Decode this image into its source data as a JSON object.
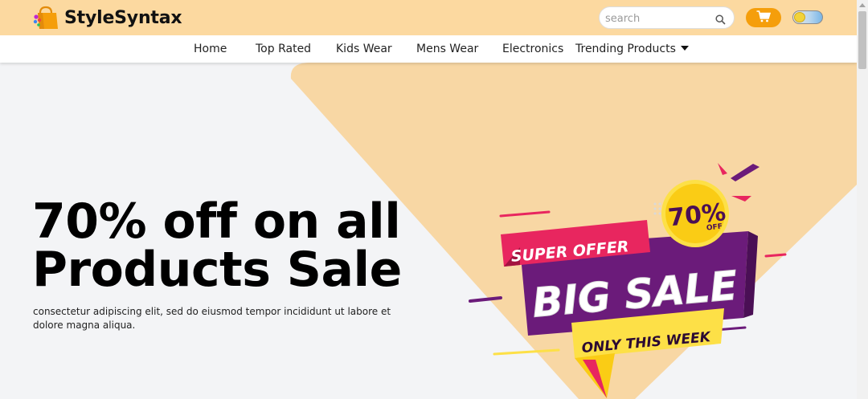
{
  "header": {
    "brand": "StyleSyntax",
    "search_placeholder": "search",
    "cart_icon": "cart-icon",
    "theme_toggle_icon": "theme-toggle"
  },
  "nav": {
    "items": [
      {
        "label": "Home"
      },
      {
        "label": "Top Rated"
      },
      {
        "label": "Kids Wear"
      },
      {
        "label": "Mens Wear"
      },
      {
        "label": "Electronics"
      },
      {
        "label": "Trending Products"
      }
    ]
  },
  "hero": {
    "title_line1": "70% off on all",
    "title_line2": "Products Sale",
    "description": "consectetur adipiscing elit, sed do eiusmod tempor incididunt ut labore et dolore magna aliqua."
  },
  "promo": {
    "badge_percent": "70%",
    "badge_off": "OFF",
    "super_offer": "SUPER OFFER",
    "big_sale": "BIG SALE",
    "only_this_week": "ONLY THIS WEEK"
  },
  "colors": {
    "header_bg": "#fcd9a0",
    "accent": "#f59e0b",
    "hero_shape": "#f8d7a4",
    "promo_purple": "#6b1b7a",
    "promo_pink": "#e8265f",
    "promo_yellow": "#fde047"
  }
}
